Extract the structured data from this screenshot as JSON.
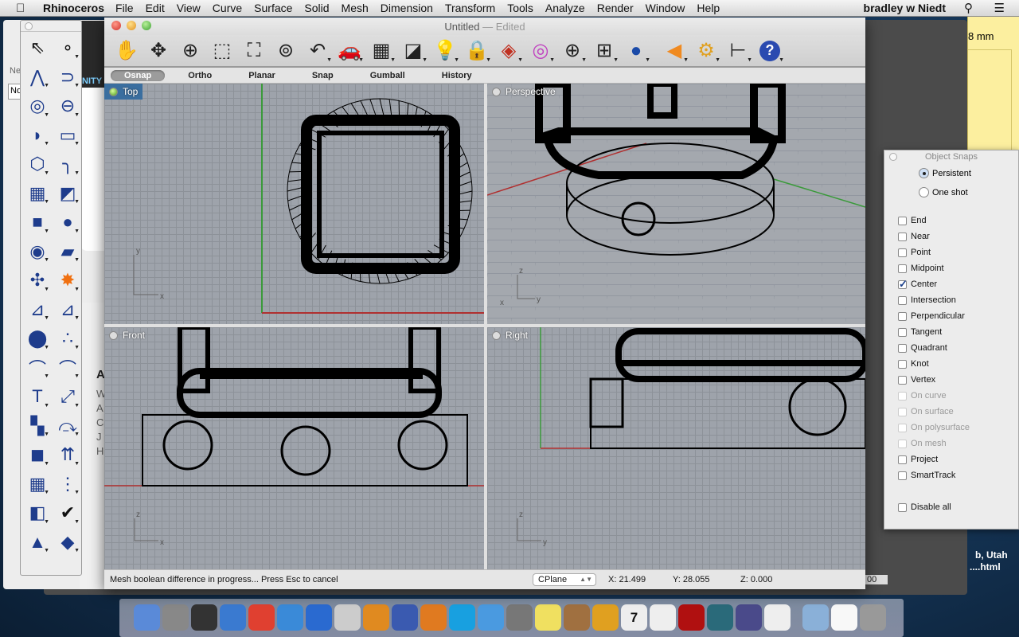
{
  "menubar": {
    "app": "Rhinoceros",
    "items": [
      "File",
      "Edit",
      "View",
      "Curve",
      "Surface",
      "Solid",
      "Mesh",
      "Dimension",
      "Transform",
      "Tools",
      "Analyze",
      "Render",
      "Window",
      "Help"
    ],
    "user": "bradley w Niedt"
  },
  "background": {
    "notes_text": "8 mm",
    "desktop_line1": "b, Utah",
    "desktop_line2": "....html",
    "status_fragment": "00",
    "left_window_label": "Ne",
    "left_window_field": "No",
    "dark_window_text": "NITY",
    "partial_letters": [
      "A",
      "W",
      "A",
      "C",
      "J",
      "H"
    ]
  },
  "window": {
    "title": "Untitled",
    "title_state": "— Edited",
    "toolbar": [
      "pan-hand",
      "rotate-view",
      "zoom-in-out",
      "zoom-window",
      "zoom-extents",
      "zoom-selected",
      "undo-view",
      "named-views-car",
      "construction-plane",
      "object-properties",
      "light-bulb-show",
      "lock",
      "layers",
      "color-wheel",
      "wireframe-view",
      "grid-shaded-view",
      "rendered-sphere",
      "render-cone",
      "options-gear",
      "dimension",
      "help"
    ],
    "modes": [
      "Osnap",
      "Ortho",
      "Planar",
      "Snap",
      "Gumball",
      "History"
    ],
    "active_mode": "Osnap",
    "viewports": {
      "top": "Top",
      "perspective": "Perspective",
      "front": "Front",
      "right": "Right"
    },
    "status": {
      "message": "Mesh boolean difference in progress... Press Esc to cancel",
      "cplane": "CPlane",
      "x": "X: 21.499",
      "y": "Y: 28.055",
      "z": "Z: 0.000"
    }
  },
  "toolbox": [
    "select-arrow",
    "point",
    "polyline",
    "curve",
    "circle",
    "ellipse",
    "arc",
    "rectangle",
    "polygon",
    "fillet-curve",
    "surface-from-points",
    "sweep-surface",
    "box-solid",
    "sphere",
    "cylinder-pipe",
    "mesh-surface",
    "boolean-union",
    "explode",
    "trim",
    "split",
    "boolean-blocks",
    "group",
    "offset-curve",
    "blend-curve",
    "text",
    "move",
    "array",
    "rotate",
    "extrude-solid",
    "project",
    "array-grid",
    "align",
    "bend",
    "check",
    "cone-primitives",
    "analyze-draft"
  ],
  "osnap": {
    "title": "Object Snaps",
    "modes": [
      {
        "label": "Persistent",
        "selected": true
      },
      {
        "label": "One shot",
        "selected": false
      }
    ],
    "items": [
      {
        "label": "End",
        "checked": false,
        "enabled": true
      },
      {
        "label": "Near",
        "checked": false,
        "enabled": true
      },
      {
        "label": "Point",
        "checked": false,
        "enabled": true
      },
      {
        "label": "Midpoint",
        "checked": false,
        "enabled": true
      },
      {
        "label": "Center",
        "checked": true,
        "enabled": true
      },
      {
        "label": "Intersection",
        "checked": false,
        "enabled": true
      },
      {
        "label": "Perpendicular",
        "checked": false,
        "enabled": true
      },
      {
        "label": "Tangent",
        "checked": false,
        "enabled": true
      },
      {
        "label": "Quadrant",
        "checked": false,
        "enabled": true
      },
      {
        "label": "Knot",
        "checked": false,
        "enabled": true
      },
      {
        "label": "Vertex",
        "checked": false,
        "enabled": true
      },
      {
        "label": "On curve",
        "checked": false,
        "enabled": false
      },
      {
        "label": "On surface",
        "checked": false,
        "enabled": false
      },
      {
        "label": "On polysurface",
        "checked": false,
        "enabled": false
      },
      {
        "label": "On mesh",
        "checked": false,
        "enabled": false
      },
      {
        "label": "Project",
        "checked": false,
        "enabled": true
      },
      {
        "label": "SmartTrack",
        "checked": false,
        "enabled": true
      }
    ],
    "disable_all": "Disable all"
  },
  "dock": [
    "finder",
    "launchpad",
    "dashboard",
    "itunes",
    "chrome",
    "safari",
    "app-store",
    "rhino-unicorn",
    "illustrator",
    "word",
    "powerpoint",
    "skype",
    "messages",
    "system-preferences",
    "stickies",
    "iphoto",
    "garageband",
    "calendar",
    "reminders",
    "photo-booth",
    "time-machine",
    "photo-app",
    "solitaire",
    "folder",
    "document",
    "trash"
  ],
  "dock_calendar_day": "7",
  "colors": {
    "active_viewport": "#3a6e9f",
    "x_axis": "#b03030",
    "y_axis": "#3a9a3a",
    "notes": "#fcef9f"
  }
}
